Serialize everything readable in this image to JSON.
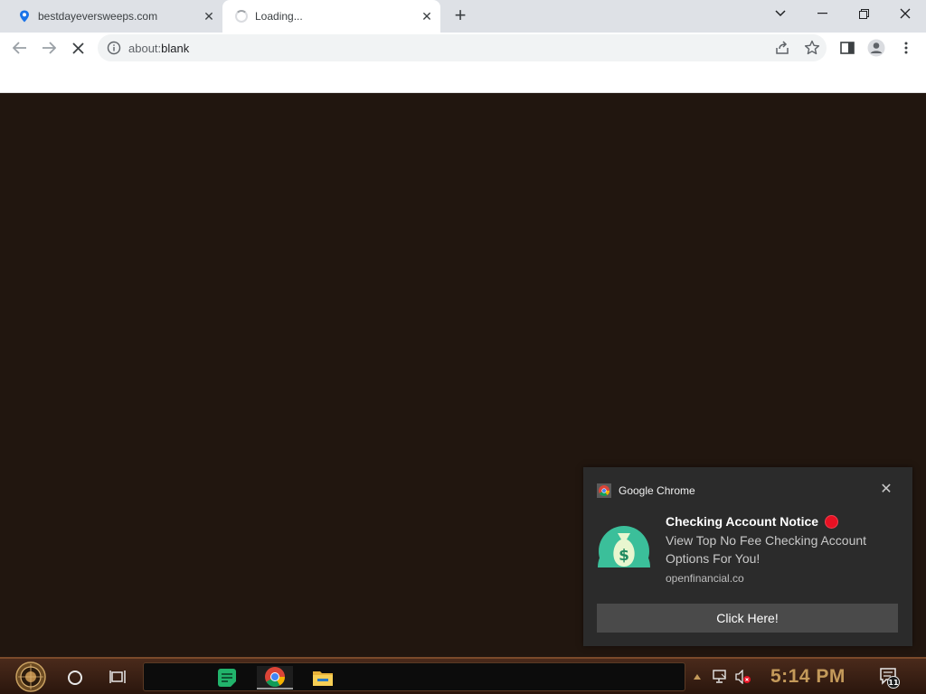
{
  "browser": {
    "tabs": [
      {
        "title": "bestdayeversweeps.com",
        "favicon": "location-pin-icon",
        "state": "idle"
      },
      {
        "title": "Loading...",
        "favicon": "spinner-icon",
        "state": "loading"
      }
    ],
    "url": {
      "scheme": "about:",
      "path": "blank"
    }
  },
  "notification": {
    "app_name": "Google Chrome",
    "title": "Checking Account Notice",
    "body": "View Top No Fee Checking Account Options For You!",
    "source": "openfinancial.co",
    "button_label": "Click Here!",
    "hero_icon": "money-bag-icon",
    "badge_color": "#e81123"
  },
  "taskbar": {
    "clock": "5:14 PM",
    "notification_count": "11",
    "pinned_apps": [
      "notes-icon",
      "chrome-icon",
      "file-explorer-icon"
    ]
  },
  "colors": {
    "page_background": "#21160f",
    "toast_background": "#2b2b2b",
    "clock_color": "#c49a5a"
  }
}
